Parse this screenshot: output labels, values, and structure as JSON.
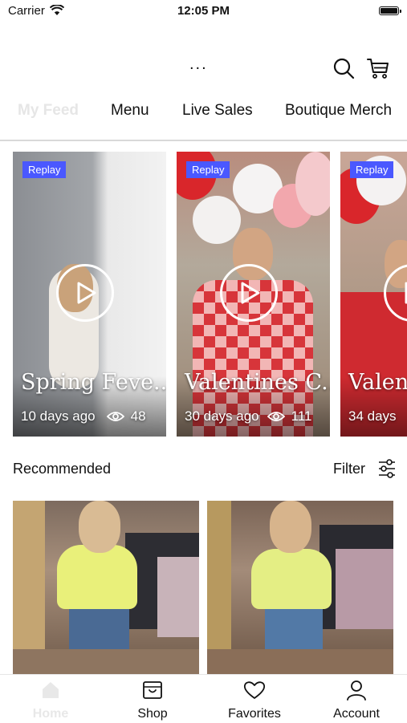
{
  "status_bar": {
    "carrier": "Carrier",
    "time": "12:05 PM"
  },
  "header": {
    "more_label": "..."
  },
  "tabs": [
    {
      "label": "My Feed"
    },
    {
      "label": "Menu"
    },
    {
      "label": "Live Sales"
    },
    {
      "label": "Boutique Merch"
    }
  ],
  "feed": {
    "cards": [
      {
        "badge": "Replay",
        "title": "Spring Feve...",
        "posted": "10 days ago",
        "views": "48"
      },
      {
        "badge": "Replay",
        "title": "Valentines C...",
        "posted": "30 days ago",
        "views": "111"
      },
      {
        "badge": "Replay",
        "title": "Valent",
        "posted": "34 days",
        "views": ""
      }
    ]
  },
  "recommended": {
    "title": "Recommended",
    "filter_label": "Filter"
  },
  "bottom_nav": [
    {
      "label": "Home",
      "icon": "home-icon"
    },
    {
      "label": "Shop",
      "icon": "shop-icon"
    },
    {
      "label": "Favorites",
      "icon": "heart-icon"
    },
    {
      "label": "Account",
      "icon": "person-icon"
    }
  ],
  "colors": {
    "accent": "#4a58ff",
    "text": "#111111",
    "faded_text": "#e6e6e6"
  }
}
